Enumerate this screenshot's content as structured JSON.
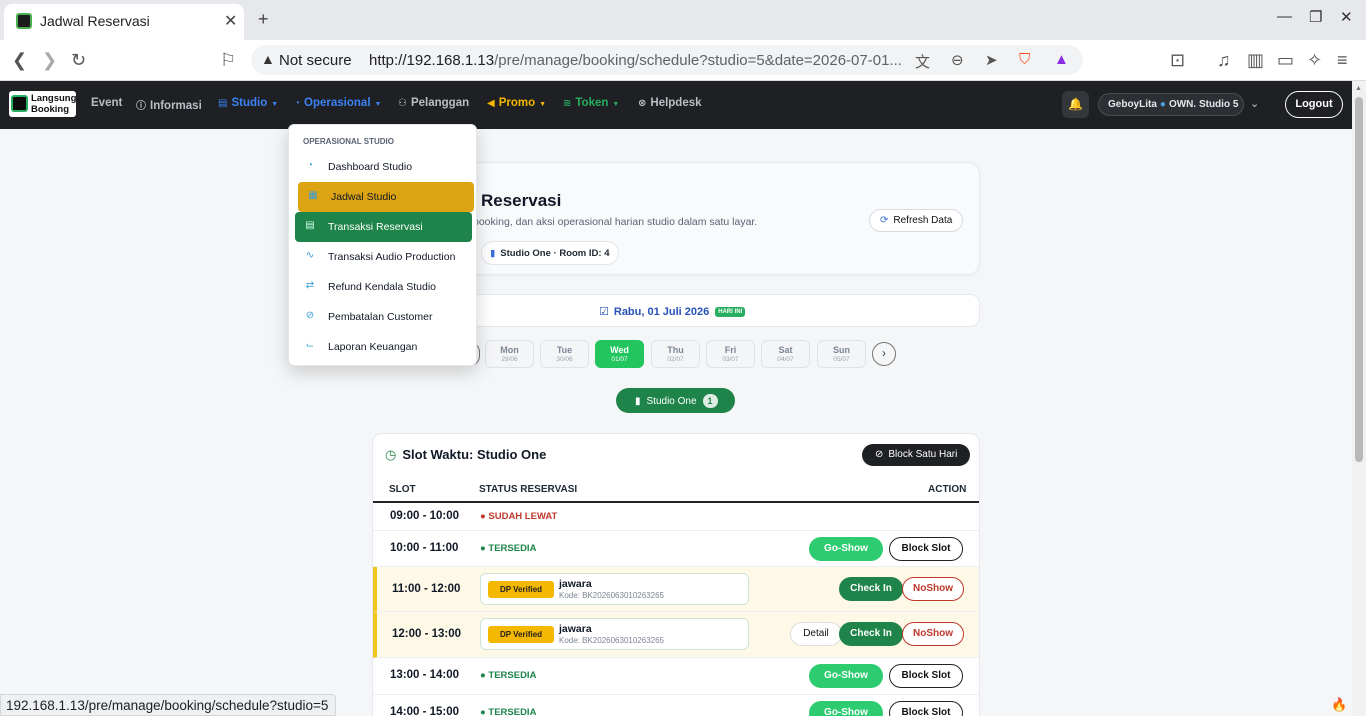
{
  "browser": {
    "tab_title": "Jadwal Reservasi",
    "tab_close": "✕",
    "new_tab": "+",
    "security_label": "Not secure",
    "url_host": "http://192.168.1.13",
    "url_path": "/pre/manage/booking/schedule?studio=5&date=2026-07-01...",
    "status_url": "192.168.1.13/pre/manage/booking/schedule?studio=5"
  },
  "nav": {
    "logo_line1": "Langsung",
    "logo_line2": "Booking",
    "items": [
      {
        "label": "Event",
        "icon": "",
        "color": "#b9bec5"
      },
      {
        "label": "Informasi",
        "icon": "ⓘ",
        "color": "#b9bec5"
      },
      {
        "label": "Studio",
        "icon": "▤",
        "color": "#3b82f6"
      },
      {
        "label": "Operasional",
        "icon": "◔",
        "color": "#3b82f6"
      },
      {
        "label": "Pelanggan",
        "icon": "👥",
        "color": "#b9bec5"
      },
      {
        "label": "Promo",
        "icon": "📣",
        "color": "#f5b800"
      },
      {
        "label": "Token",
        "icon": "≋",
        "color": "#27ae60"
      },
      {
        "label": "Helpdesk",
        "icon": "⊗",
        "color": "#b9bec5"
      }
    ],
    "user_name": "GeboyLita",
    "user_role": "OWN. Studio 5",
    "logout_label": "Logout"
  },
  "dropdown": {
    "header": "OPERASIONAL STUDIO",
    "items": [
      {
        "label": "Dashboard Studio",
        "icon": "◔"
      },
      {
        "label": "Jadwal Studio",
        "icon": "▦"
      },
      {
        "label": "Transaksi Reservasi",
        "icon": "▤"
      },
      {
        "label": "Transaksi Audio Production",
        "icon": "∿"
      },
      {
        "label": "Refund Kendala Studio",
        "icon": "⇄"
      },
      {
        "label": "Pembatalan Customer",
        "icon": "⊘"
      },
      {
        "label": "Laporan Keuangan",
        "icon": "⌙"
      }
    ]
  },
  "hero": {
    "title": "Reservasi",
    "subtitle": "booking, dan aksi operasional harian studio dalam satu layar.",
    "studio_pill": "Studio One · Room ID: 4",
    "refresh_label": "Refresh Data"
  },
  "date": {
    "label": "Rabu, 01 Juli 2026",
    "today_badge": "HARI INI"
  },
  "days": [
    {
      "name": "Mon",
      "date": "29/06",
      "active": false
    },
    {
      "name": "Tue",
      "date": "30/06",
      "active": false
    },
    {
      "name": "Wed",
      "date": "01/07",
      "active": true
    },
    {
      "name": "Thu",
      "date": "02/07",
      "active": false
    },
    {
      "name": "Fri",
      "date": "03/07",
      "active": false
    },
    {
      "name": "Sat",
      "date": "04/07",
      "active": false
    },
    {
      "name": "Sun",
      "date": "05/07",
      "active": false
    }
  ],
  "room_tab": {
    "label": "Studio One",
    "count": "1"
  },
  "slots": {
    "title": "Slot Waktu: Studio One",
    "block_day_label": "Block Satu Hari",
    "col_slot": "SLOT",
    "col_status": "STATUS RESERVASI",
    "col_action": "ACTION",
    "rows": [
      {
        "time": "09:00 - 10:00",
        "status": "SUDAH LEWAT"
      },
      {
        "time": "10:00 - 11:00",
        "status": "TERSEDIA",
        "go_show": "Go-Show",
        "block": "Block Slot"
      },
      {
        "time": "11:00 - 12:00",
        "badge": "DP Verified",
        "name": "jawara",
        "code": "Kode: BK2026063010263265",
        "check_in": "Check In",
        "no_show": "NoShow"
      },
      {
        "time": "12:00 - 13:00",
        "badge": "DP Verified",
        "name": "jawara",
        "code": "Kode: BK2026063010263265",
        "detail": "Detail",
        "check_in": "Check In",
        "no_show": "NoShow"
      },
      {
        "time": "13:00 - 14:00",
        "status": "TERSEDIA",
        "go_show": "Go-Show",
        "block": "Block Slot"
      },
      {
        "time": "14:00 - 15:00",
        "status": "TERSEDIA",
        "go_show": "Go-Show",
        "block": "Block Slot"
      }
    ]
  }
}
